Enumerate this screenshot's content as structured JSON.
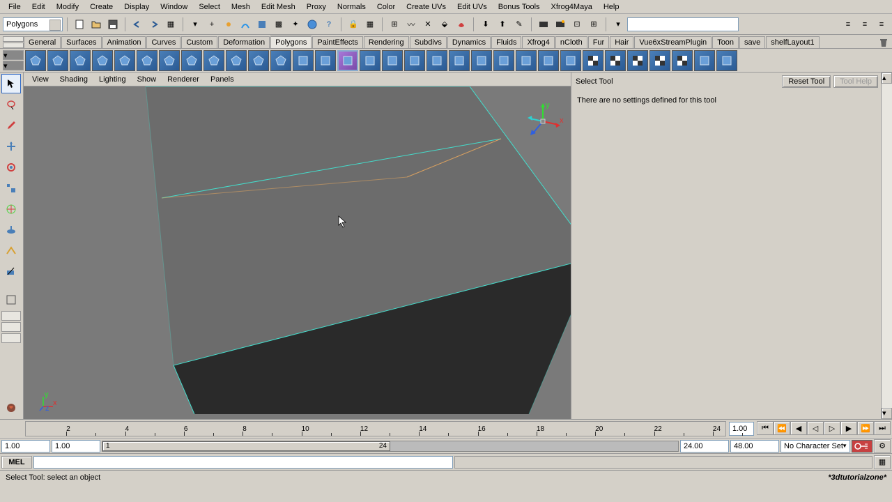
{
  "menus": [
    "File",
    "Edit",
    "Modify",
    "Create",
    "Display",
    "Window",
    "Select",
    "Mesh",
    "Edit Mesh",
    "Proxy",
    "Normals",
    "Color",
    "Create UVs",
    "Edit UVs",
    "Bonus Tools",
    "Xfrog4Maya",
    "Help"
  ],
  "mode_dropdown": "Polygons",
  "shelf_tabs": [
    "General",
    "Surfaces",
    "Animation",
    "Curves",
    "Custom",
    "Deformation",
    "Polygons",
    "PaintEffects",
    "Rendering",
    "Subdivs",
    "Dynamics",
    "Fluids",
    "Xfrog4",
    "nCloth",
    "Fur",
    "Hair",
    "Vue6xStreamPlugin",
    "Toon",
    "save",
    "shelfLayout1"
  ],
  "shelf_active": "Polygons",
  "viewport_menus": [
    "View",
    "Shading",
    "Lighting",
    "Show",
    "Renderer",
    "Panels"
  ],
  "tool_panel": {
    "title": "Select Tool",
    "reset_btn": "Reset Tool",
    "help_btn": "Tool Help",
    "message": "There are no settings defined for this tool"
  },
  "timeline": {
    "ticks": [
      {
        "v": "2",
        "p": 5.8
      },
      {
        "v": "4",
        "p": 14.2
      },
      {
        "v": "6",
        "p": 22.6
      },
      {
        "v": "8",
        "p": 31.0
      },
      {
        "v": "10",
        "p": 39.4
      },
      {
        "v": "12",
        "p": 47.8
      },
      {
        "v": "14",
        "p": 56.2
      },
      {
        "v": "16",
        "p": 64.6
      },
      {
        "v": "18",
        "p": 73.0
      },
      {
        "v": "20",
        "p": 81.4
      },
      {
        "v": "22",
        "p": 89.8
      },
      {
        "v": "24",
        "p": 98.2
      }
    ],
    "current": "1.00"
  },
  "range": {
    "start": "1.00",
    "range_start": "1.00",
    "range_end": "24.00",
    "end": "48.00",
    "char_set": "No Character Set",
    "slider_label": "24"
  },
  "command": {
    "lang": "MEL"
  },
  "status": {
    "help": "Select Tool: select an object",
    "watermark": "*3dtutorialzone*"
  },
  "axis_labels": {
    "x": "x",
    "y": "y",
    "z": "z"
  }
}
